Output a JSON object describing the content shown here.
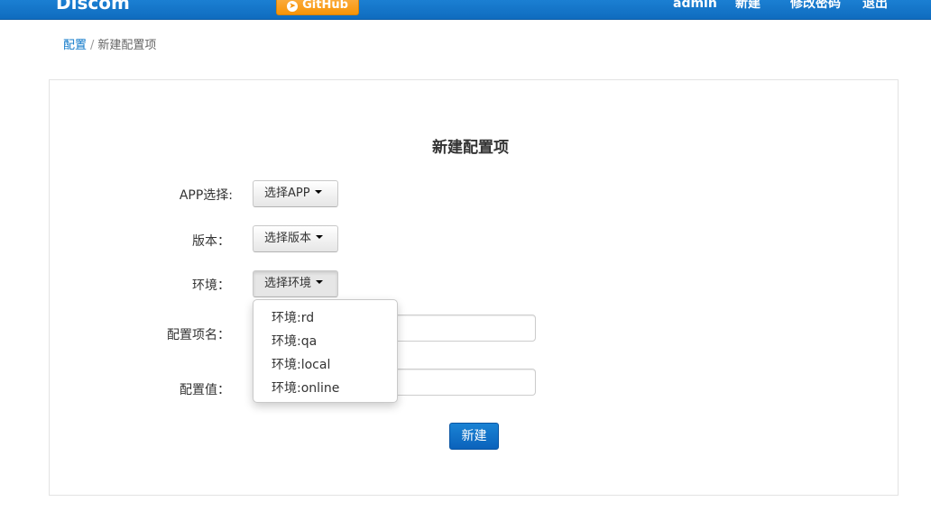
{
  "navbar": {
    "brand": "Discom",
    "github_label": "GitHub",
    "github_icon": "github-icon",
    "links": {
      "admin": "admin",
      "new": "新建",
      "change_password": "修改密码",
      "logout": "退出"
    },
    "colors": {
      "background": "#1276c9",
      "github_button": "#f89406"
    }
  },
  "breadcrumb": {
    "root": "配置",
    "separator": "/",
    "current": "新建配置项"
  },
  "form": {
    "title": "新建配置项",
    "app_label": "APP选择:",
    "app_button": "选择APP",
    "version_label": "版本：",
    "version_button": "选择版本",
    "env_label": "环境：",
    "env_button": "选择环境",
    "env_options": [
      "环境:rd",
      "环境:qa",
      "环境:local",
      "环境:online"
    ],
    "name_label": "配置项名：",
    "name_value": "",
    "value_label": "配置值：",
    "value_value": "",
    "submit_label": "新建",
    "submit_color": "#0e6fc6"
  }
}
